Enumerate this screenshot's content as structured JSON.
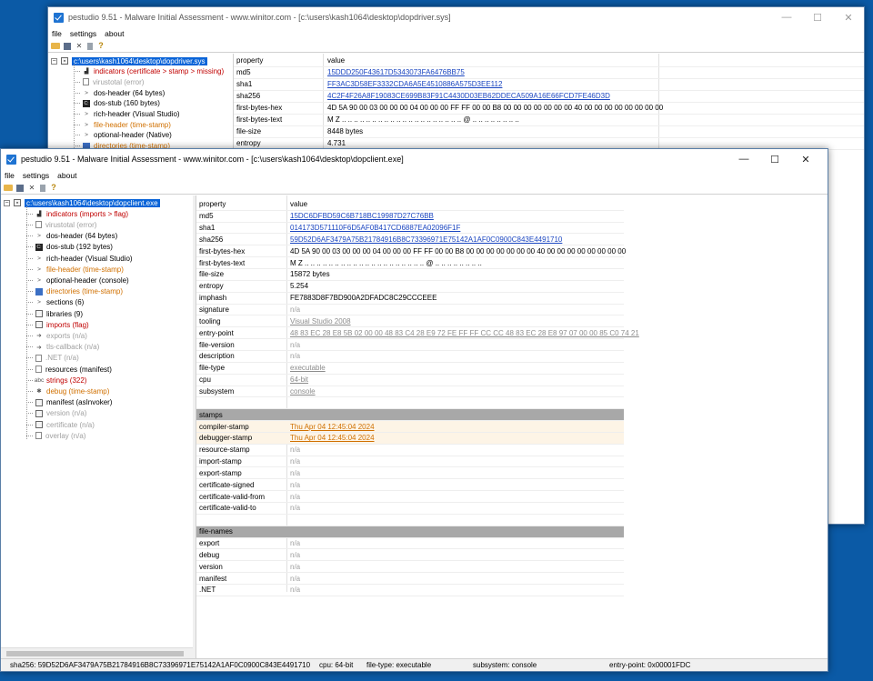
{
  "back_window": {
    "title": "pestudio 9.51 - Malware Initial Assessment - www.winitor.com - [c:\\users\\kash1064\\desktop\\dopdriver.sys]",
    "menu": [
      "file",
      "settings",
      "about"
    ],
    "tree": {
      "root": "c:\\users\\kash1064\\desktop\\dopdriver.sys",
      "items": [
        {
          "label": "indicators (certificate > stamp > missing)",
          "icon": "chart-icon",
          "color": "red"
        },
        {
          "label": "virustotal (error)",
          "icon": "page-icon",
          "color": "gray"
        },
        {
          "label": "dos-header (64 bytes)",
          "icon": "chevron-icon",
          "color": "black"
        },
        {
          "label": "dos-stub (160 bytes)",
          "icon": "dos-icon",
          "color": "black"
        },
        {
          "label": "rich-header (Visual Studio)",
          "icon": "chevron-icon",
          "color": "black"
        },
        {
          "label": "file-header (time-stamp)",
          "icon": "chevron-icon",
          "color": "orange"
        },
        {
          "label": "optional-header (Native)",
          "icon": "chevron-icon",
          "color": "black"
        },
        {
          "label": "directories (time-stamp)",
          "icon": "blue-icon",
          "color": "orange"
        }
      ]
    },
    "grid": {
      "header": {
        "property": "property",
        "value": "value"
      },
      "rows": [
        {
          "property": "md5",
          "value": "15DDD250F43617D5343073FA6476BB75",
          "style": "link"
        },
        {
          "property": "sha1",
          "value": "FF3AC3D58EF3332CDA6A5E4510886A575D3EE112",
          "style": "link"
        },
        {
          "property": "sha256",
          "value": "4C2F4F26A8F19083CE699B83F91C4430D03EB62DDECA509A16E66FCD7FE46D3D",
          "style": "link"
        },
        {
          "property": "first-bytes-hex",
          "value": "4D 5A 90 00 03 00 00 00 04 00 00 00 FF FF 00 00 B8 00 00 00 00 00 00 00 40 00 00 00 00 00 00 00 00",
          "style": "plain"
        },
        {
          "property": "first-bytes-text",
          "value": "M Z .. .. .. .. .. .. .. .. .. .. .. .. .. .. .. .. .. .. .. .. @ .. .. .. .. .. .. .. ..",
          "style": "plain"
        },
        {
          "property": "file-size",
          "value": "8448 bytes",
          "style": "plain"
        },
        {
          "property": "entropy",
          "value": "4.731",
          "style": "plain"
        }
      ]
    }
  },
  "front_window": {
    "title": "pestudio 9.51 - Malware Initial Assessment - www.winitor.com - [c:\\users\\kash1064\\desktop\\dopclient.exe]",
    "menu": [
      "file",
      "settings",
      "about"
    ],
    "tree": {
      "root": "c:\\users\\kash1064\\desktop\\dopclient.exe",
      "items": [
        {
          "label": "indicators (imports > flag)",
          "icon": "chart-icon",
          "color": "red"
        },
        {
          "label": "virustotal (error)",
          "icon": "page-icon",
          "color": "gray"
        },
        {
          "label": "dos-header (64 bytes)",
          "icon": "chevron-icon",
          "color": "black"
        },
        {
          "label": "dos-stub (192 bytes)",
          "icon": "dos-icon",
          "color": "black"
        },
        {
          "label": "rich-header (Visual Studio)",
          "icon": "chevron-icon",
          "color": "black"
        },
        {
          "label": "file-header (time-stamp)",
          "icon": "chevron-icon",
          "color": "orange"
        },
        {
          "label": "optional-header (console)",
          "icon": "chevron-icon",
          "color": "black"
        },
        {
          "label": "directories (time-stamp)",
          "icon": "blue-icon",
          "color": "orange"
        },
        {
          "label": "sections (6)",
          "icon": "chevron-icon",
          "color": "black"
        },
        {
          "label": "libraries (9)",
          "icon": "library-icon",
          "color": "black"
        },
        {
          "label": "imports (flag)",
          "icon": "library-icon",
          "color": "red"
        },
        {
          "label": "exports (n/a)",
          "icon": "arrow-icon",
          "color": "gray"
        },
        {
          "label": "tls-callback (n/a)",
          "icon": "arrow-icon",
          "color": "gray"
        },
        {
          "label": ".NET (n/a)",
          "icon": "page-icon",
          "color": "gray"
        },
        {
          "label": "resources (manifest)",
          "icon": "page-icon",
          "color": "black"
        },
        {
          "label": "strings (322)",
          "icon": "abc-icon",
          "color": "red"
        },
        {
          "label": "debug (time-stamp)",
          "icon": "bug-icon",
          "color": "orange"
        },
        {
          "label": "manifest (asInvoker)",
          "icon": "manifest-icon",
          "color": "black"
        },
        {
          "label": "version (n/a)",
          "icon": "version-icon",
          "color": "gray"
        },
        {
          "label": "certificate (n/a)",
          "icon": "certificate-icon",
          "color": "gray"
        },
        {
          "label": "overlay (n/a)",
          "icon": "page-icon",
          "color": "gray"
        }
      ]
    },
    "grid": {
      "header": {
        "property": "property",
        "value": "value"
      },
      "rows": [
        {
          "property": "md5",
          "value": "15DC6DFBD59C6B718BC19987D27C76BB",
          "style": "link"
        },
        {
          "property": "sha1",
          "value": "014173D571110F6D5AF0B417CD6887EA02096F1F",
          "style": "link"
        },
        {
          "property": "sha256",
          "value": "59D52D6AF3479A75B21784916B8C73396971E75142A1AF0C0900C843E4491710",
          "style": "link"
        },
        {
          "property": "first-bytes-hex",
          "value": "4D 5A 90 00 03 00 00 00 04 00 00 00 FF FF 00 00 B8 00 00 00 00 00 00 00 40 00 00 00 00 00 00 00 00",
          "style": "plain"
        },
        {
          "property": "first-bytes-text",
          "value": "M Z .. .. .. .. .. .. .. .. .. .. .. .. .. .. .. .. .. .. .. .. @ .. .. .. .. .. .. .. ..",
          "style": "plain"
        },
        {
          "property": "file-size",
          "value": "15872 bytes",
          "style": "plain"
        },
        {
          "property": "entropy",
          "value": "5.254",
          "style": "plain"
        },
        {
          "property": "imphash",
          "value": "FE7883D8F7BD900A2DFADC8C29CCCEEE",
          "style": "plain"
        },
        {
          "property": "signature",
          "value": "n/a",
          "style": "na"
        },
        {
          "property": "tooling",
          "value": "Visual Studio 2008",
          "style": "glink"
        },
        {
          "property": "entry-point",
          "value": "48 83 EC 28 E8 5B 02 00 00 48 83 C4 28 E9 72 FE FF FF CC CC 48 83 EC 28 E8 97 07 00 00 85 C0 74 21",
          "style": "glink"
        },
        {
          "property": "file-version",
          "value": "n/a",
          "style": "na"
        },
        {
          "property": "description",
          "value": "n/a",
          "style": "na"
        },
        {
          "property": "file-type",
          "value": "executable",
          "style": "glink"
        },
        {
          "property": "cpu",
          "value": "64-bit",
          "style": "glink"
        },
        {
          "property": "subsystem",
          "value": "console",
          "style": "glink"
        },
        {
          "property": "",
          "value": "",
          "style": "blank"
        },
        {
          "property": "stamps",
          "value": "",
          "style": "section"
        },
        {
          "property": "compiler-stamp",
          "value": "Thu Apr 04 12:45:04 2024",
          "style": "olink"
        },
        {
          "property": "debugger-stamp",
          "value": "Thu Apr 04 12:45:04 2024",
          "style": "olink"
        },
        {
          "property": "resource-stamp",
          "value": "n/a",
          "style": "na"
        },
        {
          "property": "import-stamp",
          "value": "n/a",
          "style": "na"
        },
        {
          "property": "export-stamp",
          "value": "n/a",
          "style": "na"
        },
        {
          "property": "certificate-signed",
          "value": "n/a",
          "style": "na"
        },
        {
          "property": "certificate-valid-from",
          "value": "n/a",
          "style": "na"
        },
        {
          "property": "certificate-valid-to",
          "value": "n/a",
          "style": "na"
        },
        {
          "property": "",
          "value": "",
          "style": "blank"
        },
        {
          "property": "file-names",
          "value": "",
          "style": "section"
        },
        {
          "property": "export",
          "value": "n/a",
          "style": "na"
        },
        {
          "property": "debug",
          "value": "n/a",
          "style": "na"
        },
        {
          "property": "version",
          "value": "n/a",
          "style": "na"
        },
        {
          "property": "manifest",
          "value": "n/a",
          "style": "na"
        },
        {
          "property": ".NET",
          "value": "n/a",
          "style": "na"
        }
      ]
    },
    "status": {
      "sha256": "sha256: 59D52D6AF3479A75B21784916B8C73396971E75142A1AF0C0900C843E4491710",
      "cpu": "cpu: 64-bit",
      "file_type": "file-type: executable",
      "subsystem": "subsystem: console",
      "entry_point": "entry-point: 0x00001FDC"
    }
  },
  "colors": {
    "desktop": "#0b5aa6",
    "selection": "#0a64d8",
    "link": "#1a45c0",
    "red": "#c00000",
    "orange": "#d07000",
    "gray": "#a0a0a0"
  }
}
